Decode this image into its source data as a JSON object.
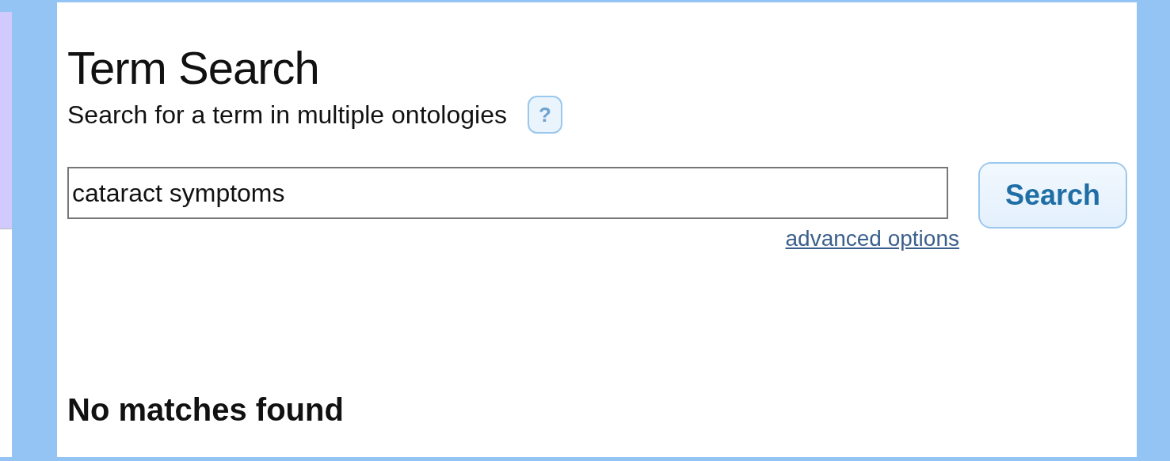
{
  "title": "Term Search",
  "subtitle": "Search for a term in multiple ontologies",
  "help": {
    "label": "?"
  },
  "search": {
    "value": "cataract symptoms",
    "button": "Search",
    "advanced_link": "advanced options"
  },
  "result_message": "No matches found"
}
